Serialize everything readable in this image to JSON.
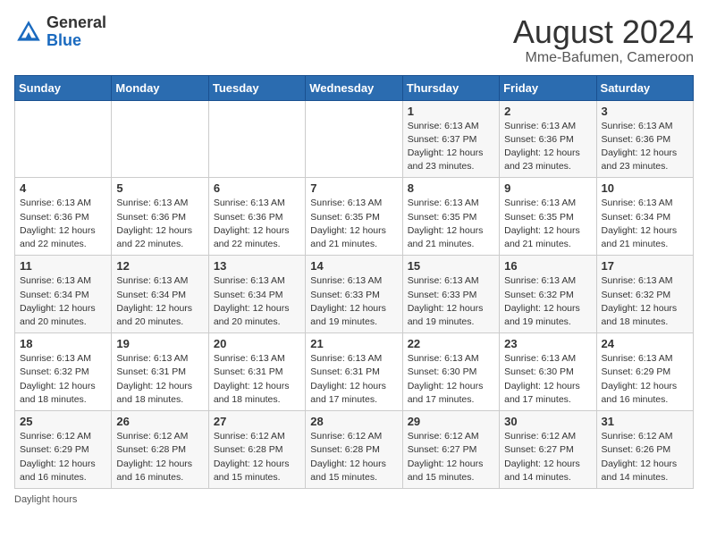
{
  "header": {
    "logo_line1": "General",
    "logo_line2": "Blue",
    "month_title": "August 2024",
    "location": "Mme-Bafumen, Cameroon"
  },
  "weekdays": [
    "Sunday",
    "Monday",
    "Tuesday",
    "Wednesday",
    "Thursday",
    "Friday",
    "Saturday"
  ],
  "weeks": [
    [
      {
        "day": "",
        "info": ""
      },
      {
        "day": "",
        "info": ""
      },
      {
        "day": "",
        "info": ""
      },
      {
        "day": "",
        "info": ""
      },
      {
        "day": "1",
        "info": "Sunrise: 6:13 AM\nSunset: 6:37 PM\nDaylight: 12 hours\nand 23 minutes."
      },
      {
        "day": "2",
        "info": "Sunrise: 6:13 AM\nSunset: 6:36 PM\nDaylight: 12 hours\nand 23 minutes."
      },
      {
        "day": "3",
        "info": "Sunrise: 6:13 AM\nSunset: 6:36 PM\nDaylight: 12 hours\nand 23 minutes."
      }
    ],
    [
      {
        "day": "4",
        "info": "Sunrise: 6:13 AM\nSunset: 6:36 PM\nDaylight: 12 hours\nand 22 minutes."
      },
      {
        "day": "5",
        "info": "Sunrise: 6:13 AM\nSunset: 6:36 PM\nDaylight: 12 hours\nand 22 minutes."
      },
      {
        "day": "6",
        "info": "Sunrise: 6:13 AM\nSunset: 6:36 PM\nDaylight: 12 hours\nand 22 minutes."
      },
      {
        "day": "7",
        "info": "Sunrise: 6:13 AM\nSunset: 6:35 PM\nDaylight: 12 hours\nand 21 minutes."
      },
      {
        "day": "8",
        "info": "Sunrise: 6:13 AM\nSunset: 6:35 PM\nDaylight: 12 hours\nand 21 minutes."
      },
      {
        "day": "9",
        "info": "Sunrise: 6:13 AM\nSunset: 6:35 PM\nDaylight: 12 hours\nand 21 minutes."
      },
      {
        "day": "10",
        "info": "Sunrise: 6:13 AM\nSunset: 6:34 PM\nDaylight: 12 hours\nand 21 minutes."
      }
    ],
    [
      {
        "day": "11",
        "info": "Sunrise: 6:13 AM\nSunset: 6:34 PM\nDaylight: 12 hours\nand 20 minutes."
      },
      {
        "day": "12",
        "info": "Sunrise: 6:13 AM\nSunset: 6:34 PM\nDaylight: 12 hours\nand 20 minutes."
      },
      {
        "day": "13",
        "info": "Sunrise: 6:13 AM\nSunset: 6:34 PM\nDaylight: 12 hours\nand 20 minutes."
      },
      {
        "day": "14",
        "info": "Sunrise: 6:13 AM\nSunset: 6:33 PM\nDaylight: 12 hours\nand 19 minutes."
      },
      {
        "day": "15",
        "info": "Sunrise: 6:13 AM\nSunset: 6:33 PM\nDaylight: 12 hours\nand 19 minutes."
      },
      {
        "day": "16",
        "info": "Sunrise: 6:13 AM\nSunset: 6:32 PM\nDaylight: 12 hours\nand 19 minutes."
      },
      {
        "day": "17",
        "info": "Sunrise: 6:13 AM\nSunset: 6:32 PM\nDaylight: 12 hours\nand 18 minutes."
      }
    ],
    [
      {
        "day": "18",
        "info": "Sunrise: 6:13 AM\nSunset: 6:32 PM\nDaylight: 12 hours\nand 18 minutes."
      },
      {
        "day": "19",
        "info": "Sunrise: 6:13 AM\nSunset: 6:31 PM\nDaylight: 12 hours\nand 18 minutes."
      },
      {
        "day": "20",
        "info": "Sunrise: 6:13 AM\nSunset: 6:31 PM\nDaylight: 12 hours\nand 18 minutes."
      },
      {
        "day": "21",
        "info": "Sunrise: 6:13 AM\nSunset: 6:31 PM\nDaylight: 12 hours\nand 17 minutes."
      },
      {
        "day": "22",
        "info": "Sunrise: 6:13 AM\nSunset: 6:30 PM\nDaylight: 12 hours\nand 17 minutes."
      },
      {
        "day": "23",
        "info": "Sunrise: 6:13 AM\nSunset: 6:30 PM\nDaylight: 12 hours\nand 17 minutes."
      },
      {
        "day": "24",
        "info": "Sunrise: 6:13 AM\nSunset: 6:29 PM\nDaylight: 12 hours\nand 16 minutes."
      }
    ],
    [
      {
        "day": "25",
        "info": "Sunrise: 6:12 AM\nSunset: 6:29 PM\nDaylight: 12 hours\nand 16 minutes."
      },
      {
        "day": "26",
        "info": "Sunrise: 6:12 AM\nSunset: 6:28 PM\nDaylight: 12 hours\nand 16 minutes."
      },
      {
        "day": "27",
        "info": "Sunrise: 6:12 AM\nSunset: 6:28 PM\nDaylight: 12 hours\nand 15 minutes."
      },
      {
        "day": "28",
        "info": "Sunrise: 6:12 AM\nSunset: 6:28 PM\nDaylight: 12 hours\nand 15 minutes."
      },
      {
        "day": "29",
        "info": "Sunrise: 6:12 AM\nSunset: 6:27 PM\nDaylight: 12 hours\nand 15 minutes."
      },
      {
        "day": "30",
        "info": "Sunrise: 6:12 AM\nSunset: 6:27 PM\nDaylight: 12 hours\nand 14 minutes."
      },
      {
        "day": "31",
        "info": "Sunrise: 6:12 AM\nSunset: 6:26 PM\nDaylight: 12 hours\nand 14 minutes."
      }
    ]
  ],
  "footer": "Daylight hours"
}
